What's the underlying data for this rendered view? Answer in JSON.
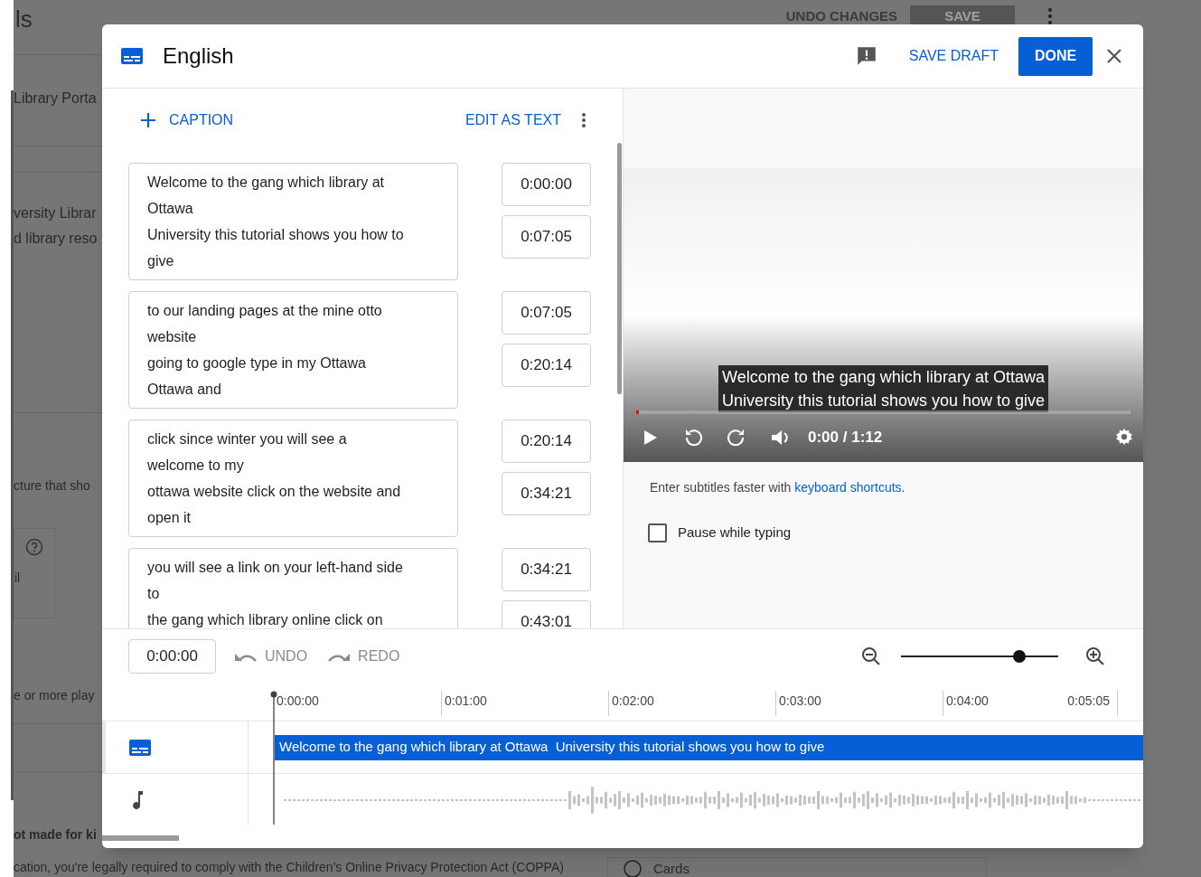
{
  "background": {
    "title": "ls",
    "actions": [
      {
        "label": "UNDO CHANGES",
        "kind": "text"
      },
      {
        "label": "SAVE",
        "kind": "filled"
      }
    ],
    "lines": [
      {
        "text": "Library Porta",
        "kind": "row"
      },
      {
        "text": "versity Librar",
        "kind": "row"
      },
      {
        "text": "d library reso",
        "kind": "row"
      },
      {
        "text": "cture that sho",
        "kind": "plain"
      },
      {
        "text": "il",
        "kind": "help"
      },
      {
        "text": "e or more play",
        "kind": "plain"
      },
      {
        "text": "ot made for ki",
        "kind": "bold"
      }
    ],
    "coppa": "cation, you're legally required to comply with the Children's Online Privacy Protection Act (COPPA)",
    "card_label": "Cards"
  },
  "dialog": {
    "title": "English",
    "save_draft": "SAVE DRAFT",
    "done": "DONE",
    "toolbar": {
      "add": "CAPTION",
      "edit_as_text": "EDIT AS TEXT"
    },
    "captions": [
      {
        "lines": [
          "Welcome to the gang which library at",
          "Ottawa",
          "University this tutorial shows you how to",
          "give"
        ],
        "start": "0:00:00",
        "end": "0:07:05"
      },
      {
        "lines": [
          "to our landing pages at the mine otto",
          "website",
          "going to google type in my Ottawa",
          "Ottawa and"
        ],
        "start": "0:07:05",
        "end": "0:20:14"
      },
      {
        "lines": [
          "click since winter you will see a",
          "welcome to my",
          "ottawa website click on the website and",
          "open it"
        ],
        "start": "0:20:14",
        "end": "0:34:21"
      },
      {
        "lines": [
          "you will see a link on your left-hand side",
          "to",
          "the gang which library online click on"
        ],
        "start": "0:34:21",
        "end": "0:43:01"
      }
    ],
    "player": {
      "subtitle": [
        "Welcome to the gang which library at Ottawa",
        "University this tutorial shows you how to give"
      ],
      "time": "0:00 / 1:12",
      "level": 0.005
    },
    "hint": {
      "text": "Enter subtitles faster with ",
      "link": "keyboard shortcuts",
      "after": "."
    },
    "pause_while_typing": {
      "label": "Pause while typing",
      "checked": false
    },
    "timeline": {
      "time": "0:00:00",
      "undo": {
        "label": "UNDO",
        "disabled": true
      },
      "redo": {
        "label": "REDO",
        "disabled": true
      },
      "zoom": {
        "level": 0.75
      },
      "ticks": [
        "0:00:00",
        "0:01:00",
        "0:02:00",
        "0:03:00",
        "0:04:00",
        "0:05:05"
      ],
      "tracks": [
        {
          "kind": "captions",
          "selected": true,
          "segment": "Welcome to the gang which library at Ottawa  University this tutorial shows you how to give"
        },
        {
          "kind": "audio",
          "selected": false
        }
      ]
    }
  }
}
